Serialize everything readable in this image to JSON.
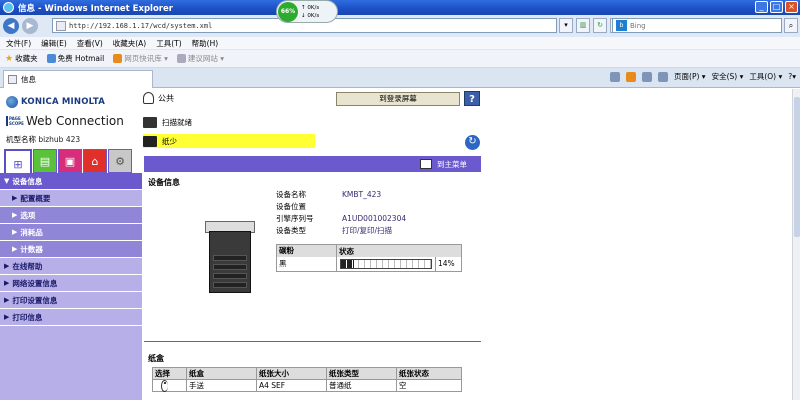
{
  "window": {
    "title": "信息 - Windows Internet Explorer",
    "min": "_",
    "max": "□",
    "close": "×"
  },
  "netwidget": {
    "percent": "66%",
    "up_rate": "0K/s",
    "down_rate": "0K/s"
  },
  "addressbar": {
    "url": "http://192.168.1.17/wcd/system.xml",
    "search_placeholder": "Bing",
    "search_engine_icon": "bing-icon"
  },
  "menu": [
    "文件(F)",
    "编辑(E)",
    "查看(V)",
    "收藏夹(A)",
    "工具(T)",
    "帮助(H)"
  ],
  "favorites": {
    "label": "收藏夹",
    "items": [
      {
        "label": "免费 Hotmail",
        "style": "normal"
      },
      {
        "label": "网页快讯库 ▾",
        "style": "gray"
      },
      {
        "label": "建议网站 ▾",
        "style": "gray"
      }
    ]
  },
  "tab": {
    "label": "信息"
  },
  "commandbar": {
    "page": "页面(P) ▾",
    "safety": "安全(S) ▾",
    "tools": "工具(O) ▾",
    "help": "?▾"
  },
  "brand": {
    "name": "KONICA MINOLTA",
    "pagescope_line1": "PAGE",
    "pagescope_line2": "SCOPE",
    "webconnection": "Web Connection",
    "model_label": "机型名称",
    "model_value": "bizhub 423"
  },
  "user": {
    "name": "公共",
    "login_button": "到登录屏幕",
    "help": "?"
  },
  "status": {
    "scan": "扫描就绪",
    "paper": "纸少"
  },
  "topmenu": {
    "label": "到主菜单"
  },
  "nav": {
    "device_info": "设备信息",
    "subs": [
      "配置概要",
      "选项",
      "消耗品",
      "计数器"
    ],
    "online_help": "在线帮助",
    "network": "网络设置信息",
    "print_settings": "打印设置信息",
    "print_info": "打印信息"
  },
  "device": {
    "section_title": "设备信息",
    "fields": [
      {
        "k": "设备名称",
        "v": "KMBT_423"
      },
      {
        "k": "设备位置",
        "v": ""
      },
      {
        "k": "引擎序列号",
        "v": "A1UD001002304"
      },
      {
        "k": "设备类型",
        "v": "打印/复印/扫描"
      }
    ]
  },
  "toner": {
    "col1": "碳粉",
    "col2": "状态",
    "color": "黑",
    "percent_text": "14%",
    "level": 0.14
  },
  "tray": {
    "title": "纸盒",
    "headers": [
      "选择",
      "纸盒",
      "纸张大小",
      "纸张类型",
      "纸张状态"
    ],
    "rows": [
      {
        "tray": "手送",
        "size": "A4 SEF",
        "type": "普通纸",
        "status": "空"
      }
    ]
  }
}
